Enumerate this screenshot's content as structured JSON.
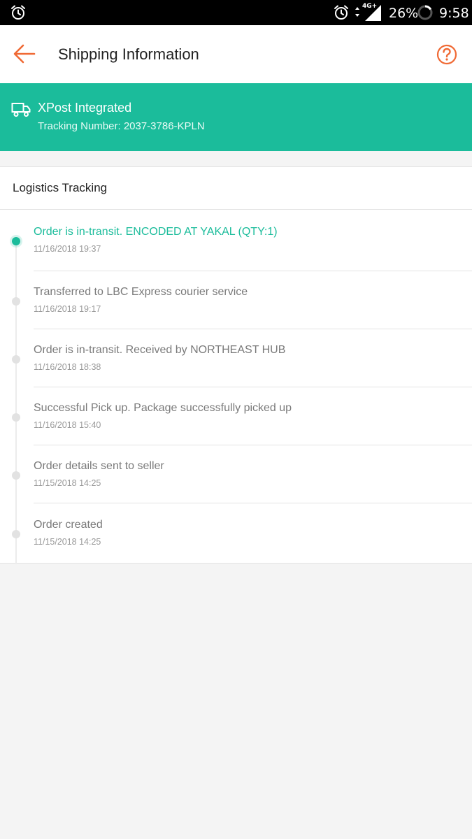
{
  "status_bar": {
    "network_type": "4G+",
    "battery": "26%",
    "time": "9:58",
    "icons": [
      "alarm-icon",
      "signal-icon",
      "battery-icon"
    ]
  },
  "app_bar": {
    "title": "Shipping Information",
    "back_icon": "arrow-left-icon",
    "help_icon": "question-circle-icon",
    "accent_color": "#f06a35"
  },
  "courier": {
    "icon": "truck-icon",
    "name": "XPost Integrated",
    "tracking_number": "Tracking Number: 2037-3786-KPLN",
    "banner_color": "#1bbc9b"
  },
  "logistics": {
    "title": "Logistics Tracking",
    "events": [
      {
        "text": "Order is in-transit. ENCODED AT YAKAL (QTY:1)",
        "time": "11/16/2018 19:37",
        "active": true
      },
      {
        "text": "Transferred to LBC Express courier service",
        "time": "11/16/2018 19:17",
        "active": false
      },
      {
        "text": "Order is in-transit. Received by NORTHEAST HUB",
        "time": "11/16/2018 18:38",
        "active": false
      },
      {
        "text": "Successful Pick up. Package successfully picked up",
        "time": "11/16/2018 15:40",
        "active": false
      },
      {
        "text": "Order details sent to seller",
        "time": "11/15/2018 14:25",
        "active": false
      },
      {
        "text": "Order created",
        "time": "11/15/2018 14:25",
        "active": false
      }
    ]
  }
}
